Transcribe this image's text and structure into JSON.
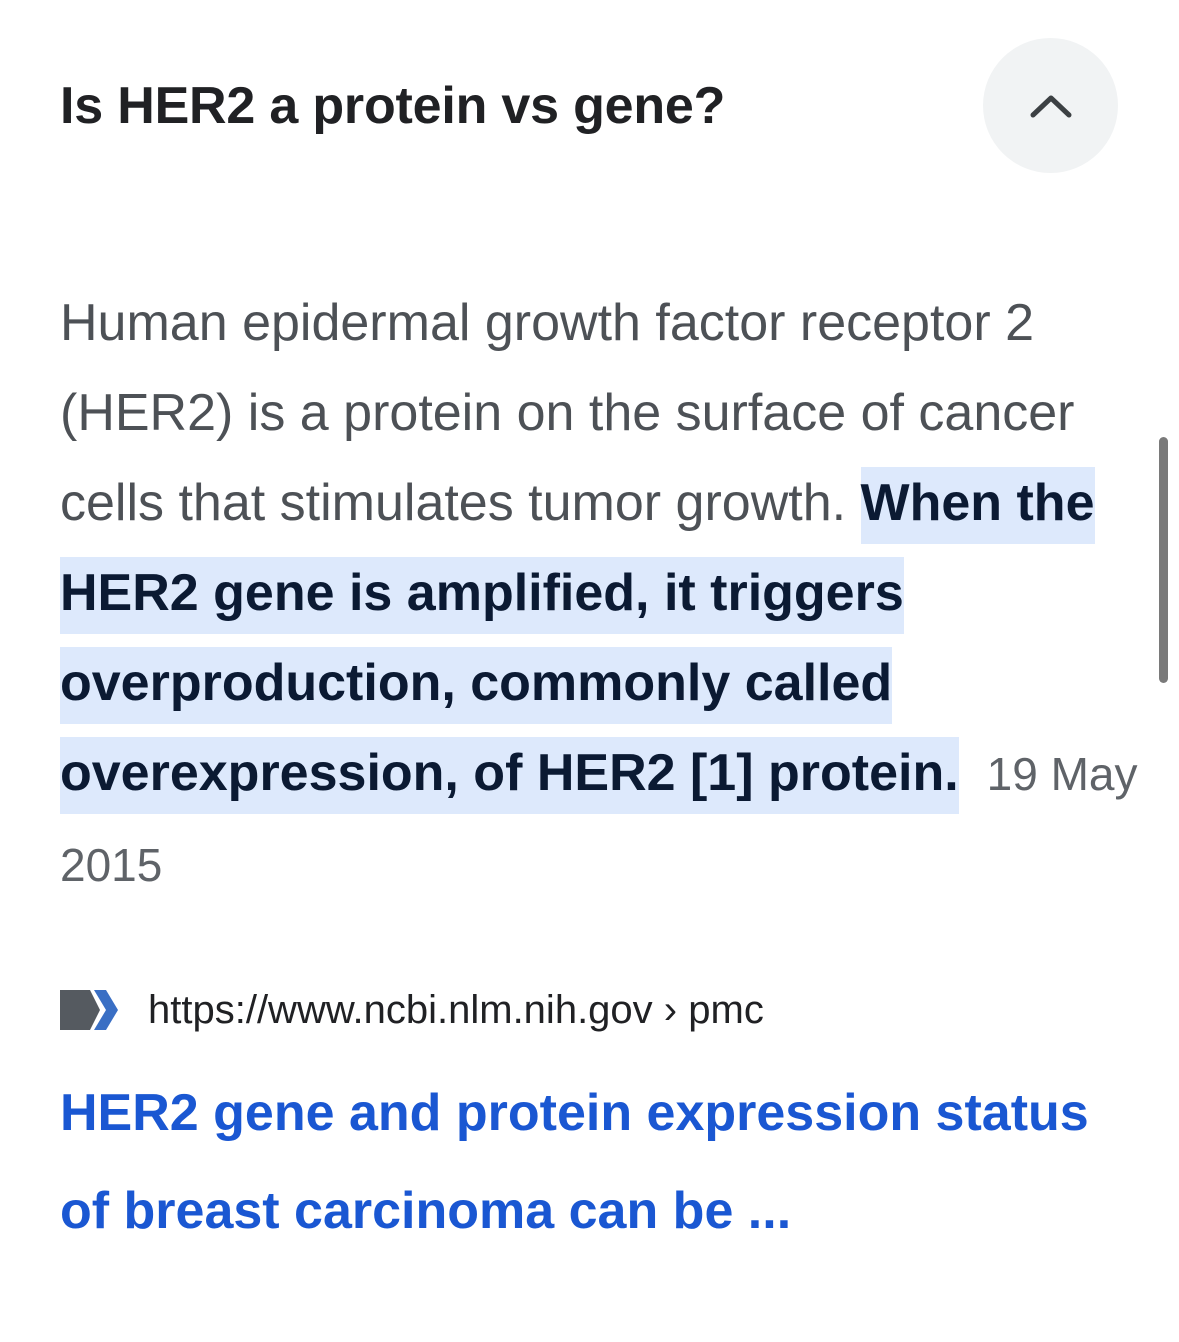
{
  "question": "Is HER2 a protein vs gene?",
  "toggle": {
    "icon": "chevron-up-icon",
    "state": "expanded"
  },
  "answer": {
    "plain_text": "Human epidermal growth factor receptor 2 (HER2) is a protein on the surface of cancer cells that stimulates tumor growth. ",
    "highlighted_text": "When the HER2 gene is amplified, it triggers overproduction, commonly called overexpression, of HER2 [1] protein.",
    "date": "19 May 2015"
  },
  "source": {
    "favicon": "ncbi-logo-icon",
    "url": "https://www.ncbi.nlm.nih.gov",
    "separator": "›",
    "path": "pmc"
  },
  "result": {
    "title": "HER2 gene and protein expression status of breast carcinoma can be ..."
  },
  "colors": {
    "question": "#202124",
    "body_text": "#4d5156",
    "highlight_bg": "#dde9fc",
    "highlight_text": "#0b1a33",
    "link": "#1a57d2",
    "toggle_bg": "#f1f3f4"
  }
}
